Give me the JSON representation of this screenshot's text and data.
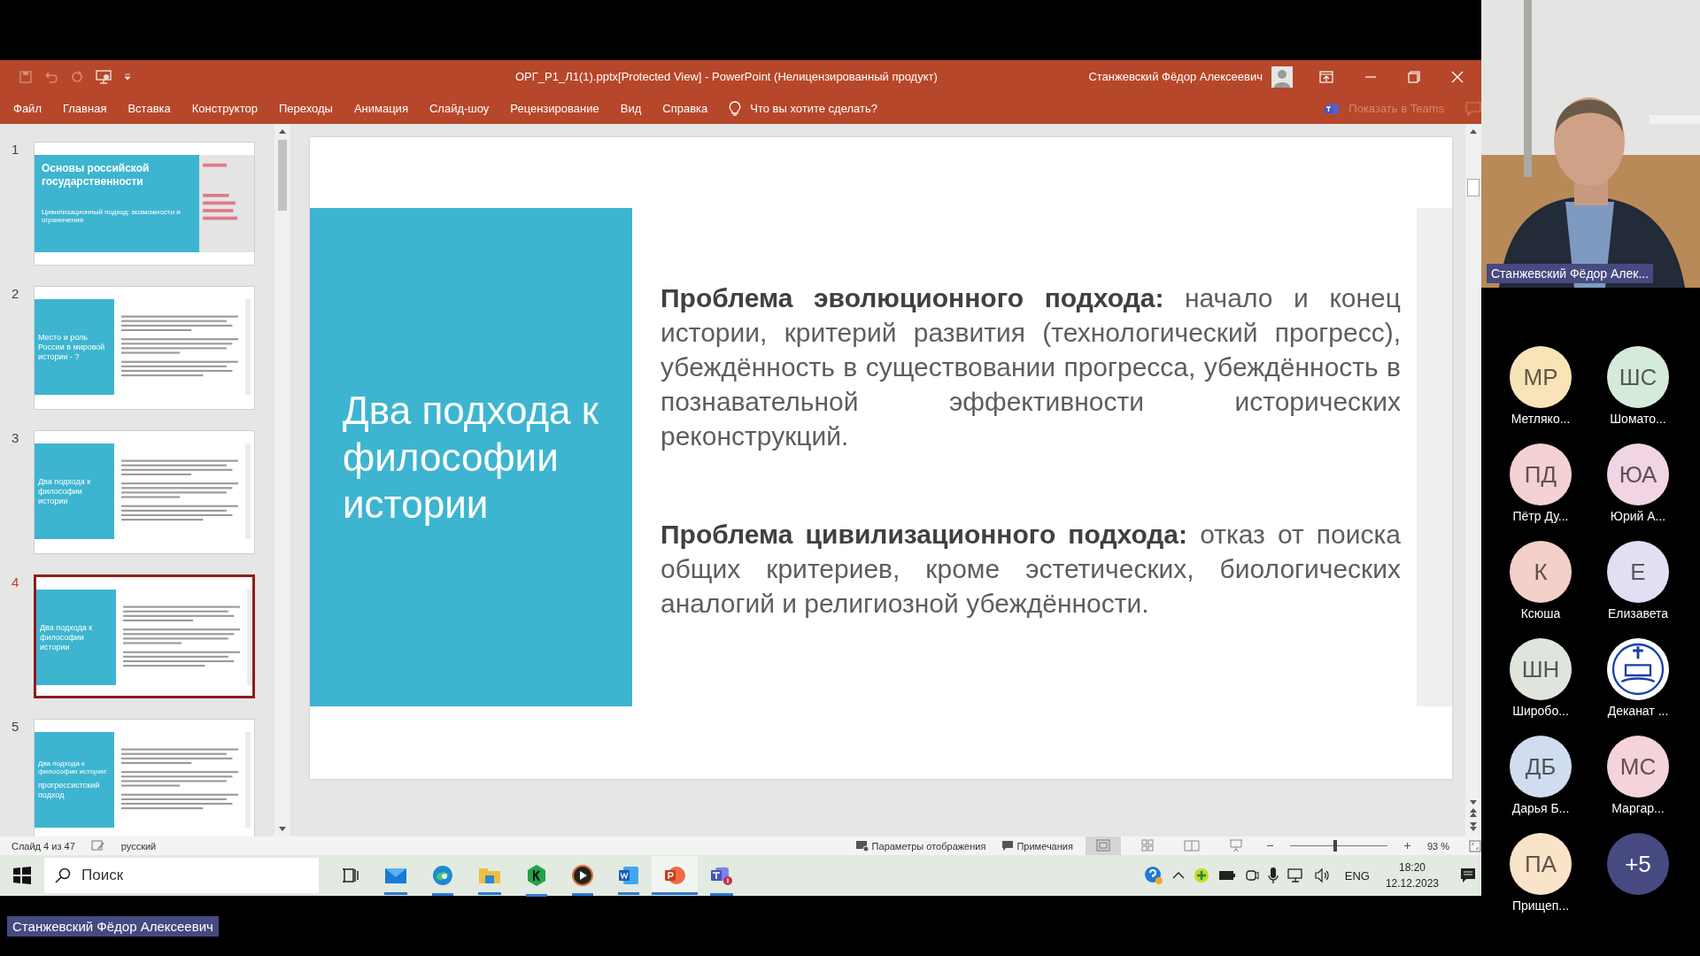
{
  "window": {
    "title": "ОРГ_Р1_Л1(1).pptx[Protected View]  -  PowerPoint (Нелицензированный продукт)",
    "user": "Станжевский Фёдор Алексеевич"
  },
  "menu": [
    {
      "label": "Файл"
    },
    {
      "label": "Главная"
    },
    {
      "label": "Вставка"
    },
    {
      "label": "Конструктор"
    },
    {
      "label": "Переходы"
    },
    {
      "label": "Анимация"
    },
    {
      "label": "Слайд-шоу"
    },
    {
      "label": "Рецензирование"
    },
    {
      "label": "Вид"
    },
    {
      "label": "Справка"
    }
  ],
  "tell_me": "Что вы хотите сделать?",
  "teams_share": "Показать в Teams",
  "thumbnails": [
    {
      "number": "1",
      "selected": false,
      "kind": "title",
      "title": "Основы российской государственности",
      "subtitle": "Цивилизационный подход: возможности и ограничения"
    },
    {
      "number": "2",
      "selected": false,
      "kind": "content",
      "title": "Место и роль России в мировой истории - ?"
    },
    {
      "number": "3",
      "selected": false,
      "kind": "content",
      "title": "Два подхода к философии истории"
    },
    {
      "number": "4",
      "selected": true,
      "kind": "content",
      "title": "Два подхода к философии истории"
    },
    {
      "number": "5",
      "selected": false,
      "kind": "content",
      "overline": "Два подхода к философии истории:",
      "title": "прогрессистский подход"
    }
  ],
  "slide": {
    "title": "Два подхода к философии истории",
    "paragraphs": [
      "**Проблема эволюционного подхода:** начало и конец истории, критерий развития (технологический прогресс), убеждённость в существовании прогресса, убеждённость в познавательной эффективности исторических реконструкций.",
      "**Проблема цивилизационного подхода:** отказ от поиска общих критериев, кроме эстетических, биологических аналогий и религиозной убеждённости."
    ]
  },
  "status_bar": {
    "slide": "Слайд 4 из 47",
    "language": "русский",
    "display_settings": "Параметры отображения",
    "notes": "Примечания",
    "zoom": "93 %",
    "level": 0.46
  },
  "taskbar": {
    "search_placeholder": "Поиск",
    "language": "ENG",
    "time": "18:20",
    "date": "12.12.2023"
  },
  "call": {
    "presenter": "Станжевский Фёдор Алек...",
    "screen_sharer": "Станжевский Фёдор Алексеевич",
    "participants": [
      {
        "kind": "initials",
        "initials": "МР",
        "name": "Метляко...",
        "color": "#f8e4b6"
      },
      {
        "kind": "initials",
        "initials": "ШС",
        "name": "Шомато...",
        "color": "#d6eadb"
      },
      {
        "kind": "initials",
        "initials": "ПД",
        "name": "Пётр Ду...",
        "color": "#f4d2d4"
      },
      {
        "kind": "initials",
        "initials": "ЮА",
        "name": "Юрий А...",
        "color": "#f1d5e4"
      },
      {
        "kind": "initials",
        "initials": "К",
        "name": "Ксюша",
        "color": "#f3d0c9"
      },
      {
        "kind": "initials",
        "initials": "Е",
        "name": "Елизавета",
        "color": "#e1dff2"
      },
      {
        "kind": "initials",
        "initials": "ШН",
        "name": "Широбо...",
        "color": "#dfe5dc"
      },
      {
        "kind": "logo",
        "name": "Деканат ...",
        "color": "#ffffff"
      },
      {
        "kind": "initials",
        "initials": "ДБ",
        "name": "Дарья Б...",
        "color": "#d0ddf0"
      },
      {
        "kind": "initials",
        "initials": "МС",
        "name": "Маргар...",
        "color": "#f4d3da"
      },
      {
        "kind": "initials",
        "initials": "ПА",
        "name": "Прищеп...",
        "color": "#f9e3c9"
      },
      {
        "kind": "more",
        "initials": "+5",
        "color": "#464a80"
      }
    ]
  }
}
